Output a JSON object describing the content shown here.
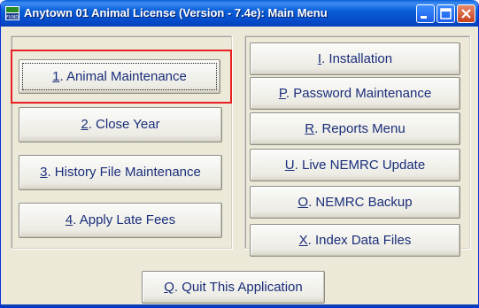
{
  "window": {
    "title": "Anytown 01 Animal License (Version - 7.4e):  Main Menu",
    "icon_label": "FUND",
    "controls": [
      "minimize-icon",
      "maximize-icon",
      "close-icon"
    ],
    "accent": "#0a5fd8"
  },
  "left_buttons": [
    {
      "key": "1",
      "label": ". Animal Maintenance",
      "focused": true
    },
    {
      "key": "2",
      "label": ". Close Year",
      "focused": false
    },
    {
      "key": "3",
      "label": ". History File Maintenance",
      "focused": false
    },
    {
      "key": "4",
      "label": ". Apply Late Fees",
      "focused": false
    }
  ],
  "right_buttons": [
    {
      "key": "I",
      "label": ".  Installation"
    },
    {
      "key": "P",
      "label": ".  Password Maintenance"
    },
    {
      "key": "R",
      "label": ".  Reports Menu"
    },
    {
      "key": "U",
      "label": ". Live NEMRC Update"
    },
    {
      "key": "O",
      "label": ". NEMRC Backup"
    },
    {
      "key": "X",
      "label": ".  Index Data Files"
    }
  ],
  "quit_button": {
    "key": "Q",
    "label": ".  Quit This Application"
  },
  "highlight_color": "#e82020"
}
